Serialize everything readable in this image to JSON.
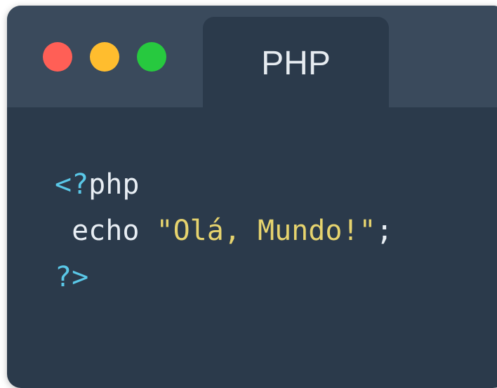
{
  "tab": {
    "label": "PHP"
  },
  "window_controls": [
    "close",
    "minimize",
    "maximize"
  ],
  "colors": {
    "close": "#ff5f56",
    "minimize": "#ffbd2e",
    "maximize": "#27c93f",
    "tag": "#5ac8e8",
    "string": "#e6d36e",
    "text": "#e8eef4",
    "background": "#2b3a4b",
    "titlebar": "#3a4a5c"
  },
  "code": {
    "line1": {
      "open_tag": "<?",
      "lang": "php"
    },
    "line2": {
      "indent": " ",
      "keyword": "echo",
      "space": " ",
      "string": "\"Olá, Mundo!\"",
      "semicolon": ";"
    },
    "line3": {
      "close_tag": "?>"
    }
  }
}
